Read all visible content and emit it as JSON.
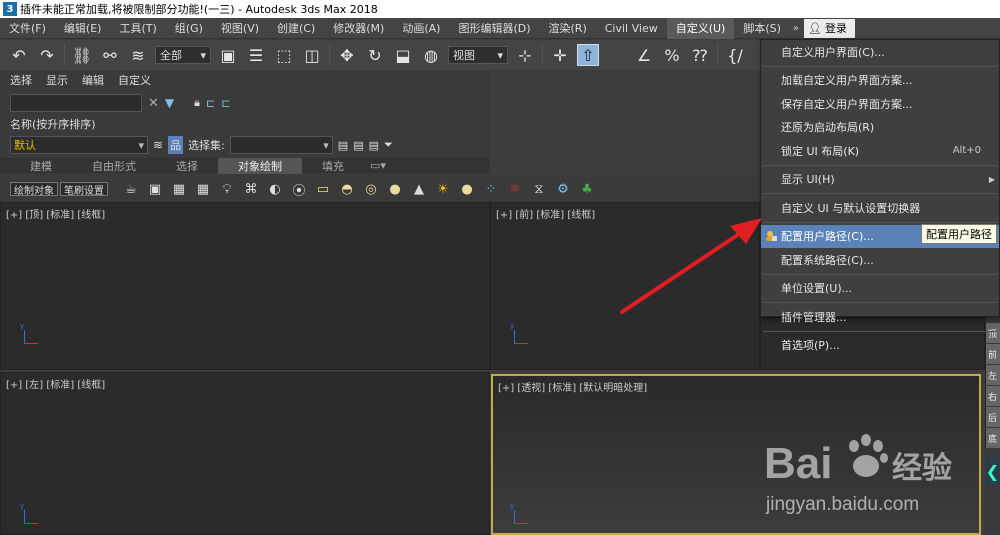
{
  "window": {
    "app_icon_letter": "3",
    "title": "插件未能正常加载,将被限制部分功能!(一三) - Autodesk 3ds Max 2018"
  },
  "menubar": {
    "items": [
      "文件(F)",
      "编辑(E)",
      "工具(T)",
      "组(G)",
      "视图(V)",
      "创建(C)",
      "修改器(M)",
      "动画(A)",
      "图形编辑器(D)",
      "渲染(R)",
      "Civil View",
      "自定义(U)",
      "脚本(S)"
    ],
    "active_item": "自定义(U)",
    "more": "»",
    "login_label": "登录"
  },
  "toolbar": {
    "filter_select": "全部",
    "view_select": "视图"
  },
  "scene_explorer": {
    "menu": [
      "选择",
      "显示",
      "编辑",
      "自定义"
    ],
    "header": "名称(按升序排序)",
    "layer_value": "默认",
    "selection_set_label": "选择集:"
  },
  "ribbon": {
    "tabs": [
      "建模",
      "自由形式",
      "选择",
      "对象绘制",
      "填充"
    ],
    "active_tab": "对象绘制",
    "paint_buttons": [
      "绘制对象",
      "笔刷设置"
    ]
  },
  "viewports": {
    "top": "[+] [顶] [标准] [线框]",
    "front": "[+] [前] [标准] [线框]",
    "left": "[+] [左] [标准] [线框]",
    "perspective": "[+] [透视] [标准] [默认明暗处理]",
    "axis_label": "y"
  },
  "dropdown": {
    "items": [
      {
        "label": "自定义用户界面(C)...",
        "shortcut": "",
        "submenu": false
      },
      {
        "sep": true
      },
      {
        "label": "加载自定义用户界面方案...",
        "shortcut": "",
        "submenu": false
      },
      {
        "label": "保存自定义用户界面方案...",
        "shortcut": "",
        "submenu": false
      },
      {
        "label": "还原为启动布局(R)",
        "shortcut": "",
        "submenu": false
      },
      {
        "label": "锁定 UI 布局(K)",
        "shortcut": "Alt+0",
        "submenu": false
      },
      {
        "sep": true
      },
      {
        "label": "显示 UI(H)",
        "shortcut": "",
        "submenu": true
      },
      {
        "sep": true
      },
      {
        "label": "自定义 UI 与默认设置切换器",
        "shortcut": "",
        "submenu": false
      },
      {
        "sep": true
      },
      {
        "label": "配置用户路径(C)...",
        "shortcut": "",
        "submenu": false,
        "highlight": true,
        "icon": true
      },
      {
        "label": "配置系统路径(C)...",
        "shortcut": "",
        "submenu": false
      },
      {
        "sep": true
      },
      {
        "label": "单位设置(U)...",
        "shortcut": "",
        "submenu": false
      },
      {
        "sep": true
      },
      {
        "label": "插件管理器...",
        "shortcut": "",
        "submenu": false
      },
      {
        "sep": true
      },
      {
        "label": "首选项(P)...",
        "shortcut": "",
        "submenu": false
      }
    ]
  },
  "tooltip": "配置用户路径",
  "command_panel": {
    "tabs": [
      "顶",
      "前",
      "左",
      "右",
      "后",
      "底"
    ]
  },
  "watermark": {
    "line1": "Bai",
    "line1_suffix": "经验",
    "url": "jingyan.baidu.com"
  },
  "colors": {
    "menu_highlight": "#5b82b8",
    "layer_text": "#e3c200",
    "arrow": "#e02020",
    "active_viewport_border": "#c8a64a"
  }
}
